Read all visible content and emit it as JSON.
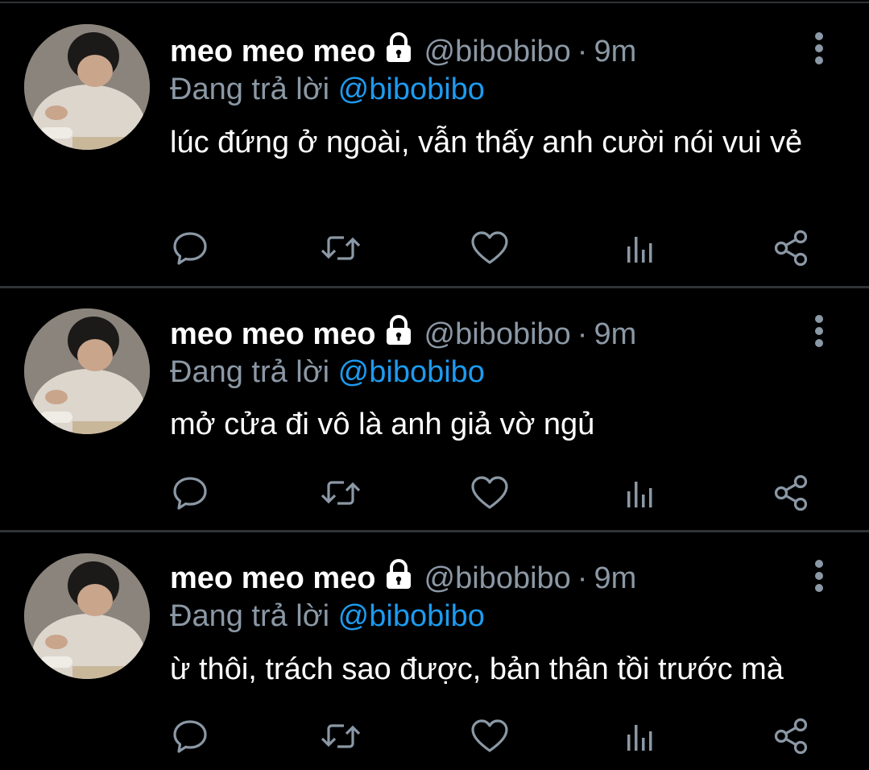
{
  "colors": {
    "background": "#000000",
    "text": "#ffffff",
    "muted": "#8b98a5",
    "mention": "#1d9bf0",
    "divider": "#2f3336"
  },
  "icons": {
    "lock": "lock-icon",
    "more": "more-vertical-icon",
    "reply": "reply-icon",
    "retweet": "retweet-icon",
    "like": "heart-icon",
    "views": "views-icon",
    "share": "share-icon"
  },
  "tweets": [
    {
      "display_name": "meo meo meo",
      "handle": "@bibobibo",
      "separator": "·",
      "time": "9m",
      "reply_prefix": "Đang trả lời",
      "reply_to": "@bibobibo",
      "text": "lúc đứng ở ngoài, vẫn thấy anh cười nói vui vẻ"
    },
    {
      "display_name": "meo meo meo",
      "handle": "@bibobibo",
      "separator": "·",
      "time": "9m",
      "reply_prefix": "Đang trả lời",
      "reply_to": "@bibobibo",
      "text": "mở cửa đi vô là anh giả vờ ngủ"
    },
    {
      "display_name": "meo meo meo",
      "handle": "@bibobibo",
      "separator": "·",
      "time": "9m",
      "reply_prefix": "Đang trả lời",
      "reply_to": "@bibobibo",
      "text": "ừ thôi, trách sao được, bản thân tồi trước mà"
    }
  ]
}
